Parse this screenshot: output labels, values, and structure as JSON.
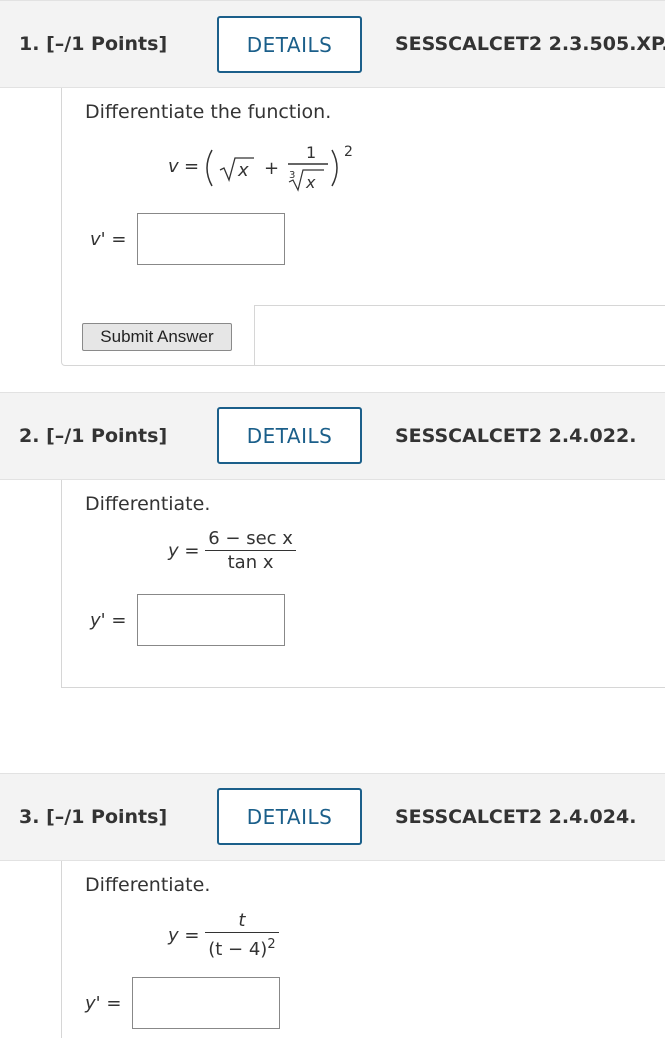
{
  "questions": [
    {
      "number": "1.",
      "points": "[–/1 Points]",
      "details_label": "DETAILS",
      "source": "SESSCALCET2 2.3.505.XP.",
      "prompt": "Differentiate the function.",
      "answer_label": "v' =",
      "submit_label": "Submit Answer"
    },
    {
      "number": "2.",
      "points": "[–/1 Points]",
      "details_label": "DETAILS",
      "source": "SESSCALCET2 2.4.022.",
      "prompt": "Differentiate.",
      "answer_label": "y' ="
    },
    {
      "number": "3.",
      "points": "[–/1 Points]",
      "details_label": "DETAILS",
      "source": "SESSCALCET2 2.4.024.",
      "prompt": "Differentiate.",
      "answer_label": "y' ="
    }
  ],
  "math": {
    "q1": {
      "lhs": "v",
      "eq": "=",
      "sqrt_arg": "x",
      "plus": "+",
      "num": "1",
      "root_index": "3",
      "root_arg": "x",
      "exponent": "2"
    },
    "q2": {
      "lhs": "y",
      "eq": "=",
      "num": "6 − sec x",
      "den": "tan x"
    },
    "q3": {
      "lhs": "y",
      "eq": "=",
      "num": "t",
      "den_base": "(t − 4)",
      "den_exp": "2"
    }
  }
}
